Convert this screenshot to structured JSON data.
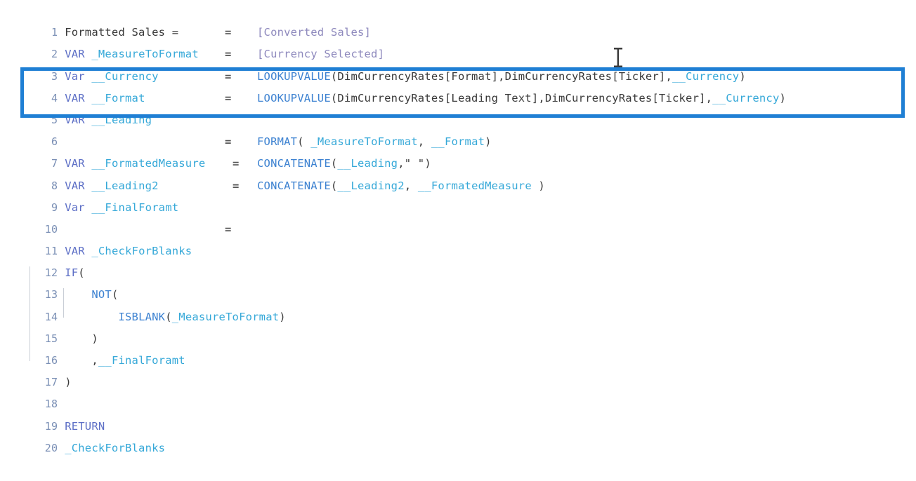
{
  "editor": {
    "language": "DAX",
    "background_color": "#ffffff",
    "highlight_box_color": "#1f7fd4",
    "cursor": "text-ibeam-cursor",
    "colors": {
      "line_number": "#7a8fb5",
      "keyword": "#5d6fc6",
      "variable": "#35a8d8",
      "measure_reference": "#8e89bd",
      "function": "#3d82d1",
      "plain": "#3a3a3a"
    },
    "lines": [
      {
        "number": "1",
        "keyword": "",
        "name": "Formatted Sales =",
        "equals": "",
        "expression": ""
      },
      {
        "number": "2",
        "keyword": "VAR",
        "name": "_MeasureToFormat",
        "equals": "=",
        "expression": "[Converted Sales]"
      },
      {
        "number": "3",
        "keyword": "Var",
        "name": "__Currency",
        "equals": "=",
        "expression": "[Currency Selected]"
      },
      {
        "number": "4",
        "keyword": "VAR",
        "name": "__Format",
        "equals": "=",
        "expression": "LOOKUPVALUE(DimCurrencyRates[Format],DimCurrencyRates[Ticker],__Currency)"
      },
      {
        "number": "5",
        "keyword": "VAR",
        "name": "__Leading",
        "equals": "=",
        "expression": "LOOKUPVALUE(DimCurrencyRates[Leading Text],DimCurrencyRates[Ticker],__Currency)"
      },
      {
        "number": "6",
        "keyword": "",
        "name": "",
        "equals": "",
        "expression": ""
      },
      {
        "number": "7",
        "keyword": "VAR",
        "name": "__FormatedMeasure",
        "equals": "=",
        "expression": "FORMAT( _MeasureToFormat, __Format)"
      },
      {
        "number": "8",
        "keyword": "VAR",
        "name": "__Leading2",
        "equals": "=",
        "expression": "CONCATENATE(__Leading,\" \")"
      },
      {
        "number": "9",
        "keyword": "Var",
        "name": "__FinalForamt",
        "equals": "=",
        "expression": "CONCATENATE(__Leading2, __FormatedMeasure )"
      },
      {
        "number": "10",
        "keyword": "",
        "name": "",
        "equals": "",
        "expression": ""
      },
      {
        "number": "11",
        "keyword": "VAR",
        "name": "_CheckForBlanks",
        "equals": "=",
        "expression": ""
      },
      {
        "number": "12",
        "keyword": "IF(",
        "name": "",
        "equals": "",
        "expression": ""
      },
      {
        "number": "13",
        "keyword": "",
        "name": "",
        "equals": "",
        "expression": "NOT("
      },
      {
        "number": "14",
        "keyword": "",
        "name": "",
        "equals": "",
        "expression": "ISBLANK(_MeasureToFormat)"
      },
      {
        "number": "15",
        "keyword": "",
        "name": "",
        "equals": "",
        "expression": ")"
      },
      {
        "number": "16",
        "keyword": "",
        "name": "",
        "equals": "",
        "expression": ",__FinalForamt"
      },
      {
        "number": "17",
        "keyword": "",
        "name": "",
        "equals": "",
        "expression": ")"
      },
      {
        "number": "18",
        "keyword": "",
        "name": "",
        "equals": "",
        "expression": ""
      },
      {
        "number": "19",
        "keyword": "RETURN",
        "name": "",
        "equals": "",
        "expression": ""
      },
      {
        "number": "20",
        "keyword": "",
        "name": "_CheckForBlanks",
        "equals": "",
        "expression": ""
      }
    ],
    "line_tokens": {
      "l1_title": "Formatted Sales =",
      "l2_kw": "VAR",
      "l2_var": "_MeasureToFormat",
      "l2_eq": "=",
      "l2_meas": "[Converted Sales]",
      "l3_kw": "Var",
      "l3_var": "__Currency",
      "l3_eq": "=",
      "l3_meas": "[Currency Selected]",
      "l4_kw": "VAR",
      "l4_var": "__Format",
      "l4_eq": "=",
      "l4_fn": "LOOKUPVALUE",
      "l4_args_a": "(DimCurrencyRates[Format],DimCurrencyRates[Ticker],",
      "l4_args_var": "__Currency",
      "l4_args_b": ")",
      "l5_kw": "VAR",
      "l5_var": "__Leading",
      "l5_eq": "=",
      "l5_fn": "LOOKUPVALUE",
      "l5_args_a": "(DimCurrencyRates[Leading Text],DimCurrencyRates[Ticker],",
      "l5_args_var": "__Currency",
      "l5_args_b": ")",
      "l7_kw": "VAR",
      "l7_var": "__FormatedMeasure",
      "l7_eq": "=",
      "l7_fn": "FORMAT",
      "l7_args_a": "( ",
      "l7_args_v1": "_MeasureToFormat",
      "l7_args_b": ", ",
      "l7_args_v2": "__Format",
      "l7_args_c": ")",
      "l8_kw": "VAR",
      "l8_var": "__Leading2",
      "l8_eq": "=",
      "l8_fn": "CONCATENATE",
      "l8_args_a": "(",
      "l8_args_v1": "__Leading",
      "l8_args_b": ",\" \")",
      "l9_kw": "Var",
      "l9_var": "__FinalForamt",
      "l9_eq": "=",
      "l9_fn": "CONCATENATE",
      "l9_args_a": "(",
      "l9_args_v1": "__Leading2",
      "l9_args_b": ", ",
      "l9_args_v2": "__FormatedMeasure",
      "l9_args_c": " )",
      "l11_kw": "VAR",
      "l11_var": "_CheckForBlanks",
      "l11_eq": "=",
      "l12_kw": "IF",
      "l12_paren": "(",
      "l13_fn": "NOT",
      "l13_paren": "(",
      "l14_fn": "ISBLANK",
      "l14_paren_a": "(",
      "l14_var": "_MeasureToFormat",
      "l14_paren_b": ")",
      "l15_paren": ")",
      "l16_comma": ",",
      "l16_var": "__FinalForamt",
      "l17_paren": ")",
      "l19_kw": "RETURN",
      "l20_var": "_CheckForBlanks"
    }
  }
}
